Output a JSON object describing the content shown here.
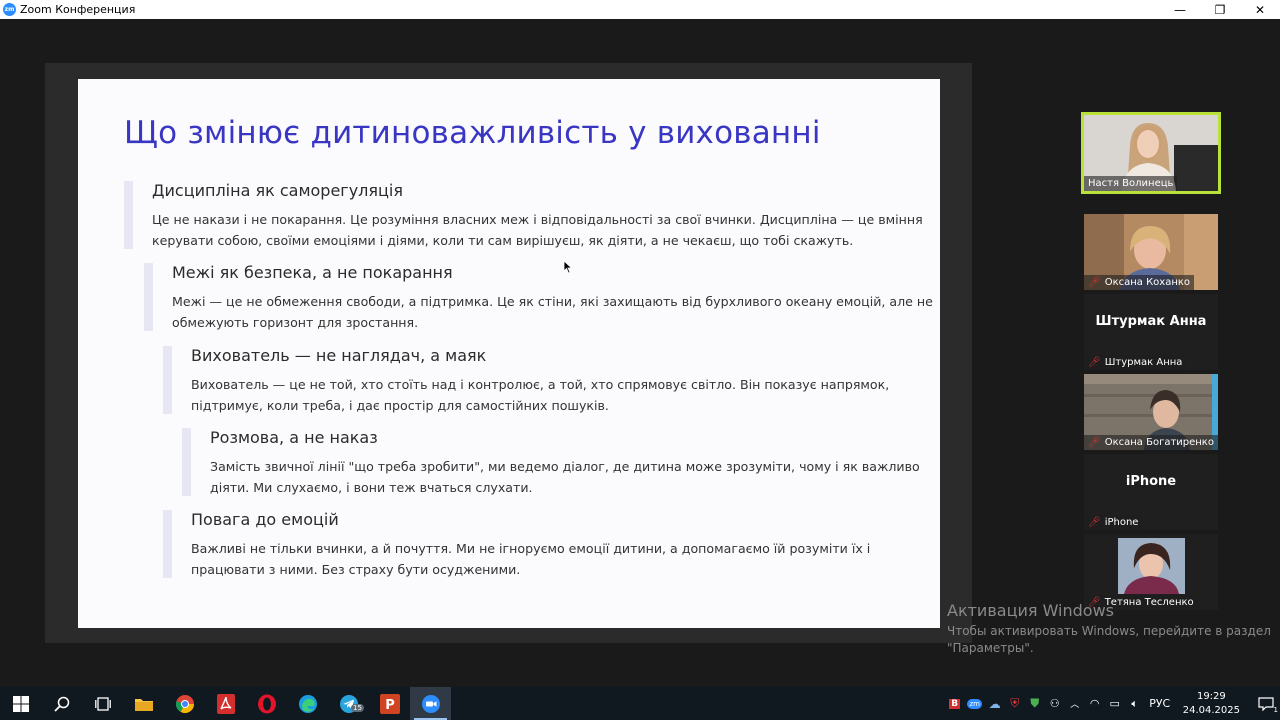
{
  "window": {
    "title": "Zoom Конференция",
    "app_icon_text": "zm",
    "minimize": "—",
    "restore": "❐",
    "close": "✕"
  },
  "slide": {
    "title": "Що змінює дитиноважливість у вихованні",
    "blocks": [
      {
        "heading": "Дисципліна як саморегуляція",
        "lines": [
          "Це не накази і не покарання. Це розуміння власних меж і відповідальності за свої вчинки. Дисципліна — це вміння",
          "керувати собою, своїми емоціями і діями, коли ти сам вирішуєш, як діяти, а не чекаєш, що тобі скажуть."
        ]
      },
      {
        "heading": "Межі як безпека, а не покарання",
        "lines": [
          "Межі — це не обмеження свободи, а підтримка. Це як стіни, які захищають від бурхливого океану емоцій, але не",
          "обмежують горизонт для зростання."
        ]
      },
      {
        "heading": "Вихователь — не наглядач, а маяк",
        "lines": [
          "Вихователь — це не той, хто стоїть над і контролює, а той, хто спрямовує світло. Він показує напрямок,",
          "підтримує, коли треба, і дає простір для самостійних пошуків."
        ]
      },
      {
        "heading": "Розмова, а не наказ",
        "lines": [
          "Замість звичної лінії \"що треба зробити\", ми ведемо діалог, де дитина може зрозуміти, чому і як важливо",
          "діяти. Ми слухаємо, і вони теж вчаться слухати."
        ]
      },
      {
        "heading": "Повага до емоцій",
        "lines": [
          "Важливі не тільки вчинки, а й почуття. Ми не ігноруємо емоції дитини, а допомагаємо їй розуміти їх і",
          "працювати з ними. Без страху бути осудженими."
        ]
      }
    ]
  },
  "participants": [
    {
      "name": "Настя Волинець",
      "muted": false,
      "active": true
    },
    {
      "name": "Оксана Коханко",
      "muted": true
    },
    {
      "name": "Штурмак Анна",
      "display": "Штурмак Анна",
      "muted": true
    },
    {
      "name": "Оксана Богатиренко",
      "muted": true
    },
    {
      "name": "iPhone",
      "display": "iPhone",
      "muted": true
    },
    {
      "name": "Тетяна Тесленко",
      "muted": true
    }
  ],
  "watermark": {
    "title": "Активация Windows",
    "line1": "Чтобы активировать Windows, перейдите в раздел",
    "line2": "\"Параметры\"."
  },
  "taskbar": {
    "clock_time": "19:29",
    "clock_date": "24.04.2025",
    "language": "РУС",
    "telegram_badge": "15",
    "notification_count": "1"
  },
  "colors": {
    "slide_title": "#3a36c4",
    "active_speaker_border": "#b8e23a",
    "mute_icon": "#e03434"
  }
}
